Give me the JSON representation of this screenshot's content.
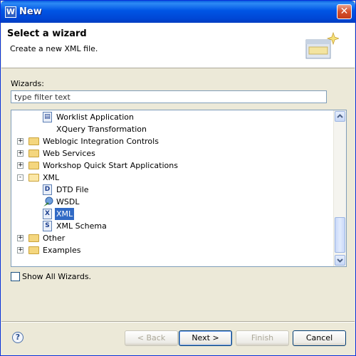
{
  "window": {
    "title": "New"
  },
  "banner": {
    "title": "Select a wizard",
    "description": "Create a new XML file."
  },
  "wizards_label": "Wizards:",
  "filter": {
    "value": "type filter text"
  },
  "tree": {
    "items": [
      {
        "label": "Worklist Application",
        "icon": "application-icon"
      },
      {
        "label": "XQuery Transformation",
        "icon": "none"
      },
      {
        "label": "Weblogic Integration Controls",
        "icon": "folder-icon",
        "expander": "+"
      },
      {
        "label": "Web Services",
        "icon": "folder-icon",
        "expander": "+"
      },
      {
        "label": "Workshop Quick Start Applications",
        "icon": "folder-icon",
        "expander": "+"
      },
      {
        "label": "XML",
        "icon": "folder-open-icon",
        "expander": "-"
      },
      {
        "label": "DTD File",
        "icon": "dtd-file-icon",
        "glyph": "D"
      },
      {
        "label": "WSDL",
        "icon": "wsdl-icon"
      },
      {
        "label": "XML",
        "icon": "xml-file-icon",
        "glyph": "X",
        "selected": true
      },
      {
        "label": "XML Schema",
        "icon": "xml-schema-icon",
        "glyph": "S"
      },
      {
        "label": "Other",
        "icon": "folder-icon",
        "expander": "+"
      },
      {
        "label": "Examples",
        "icon": "folder-icon",
        "expander": "+"
      }
    ]
  },
  "show_all": {
    "label": "Show All Wizards.",
    "checked": false
  },
  "buttons": {
    "back": "< Back",
    "next": "Next >",
    "finish": "Finish",
    "cancel": "Cancel"
  },
  "colors": {
    "selection": "#316ac5",
    "titlebar": "#0055e5",
    "dialog_bg": "#ece9d8"
  }
}
